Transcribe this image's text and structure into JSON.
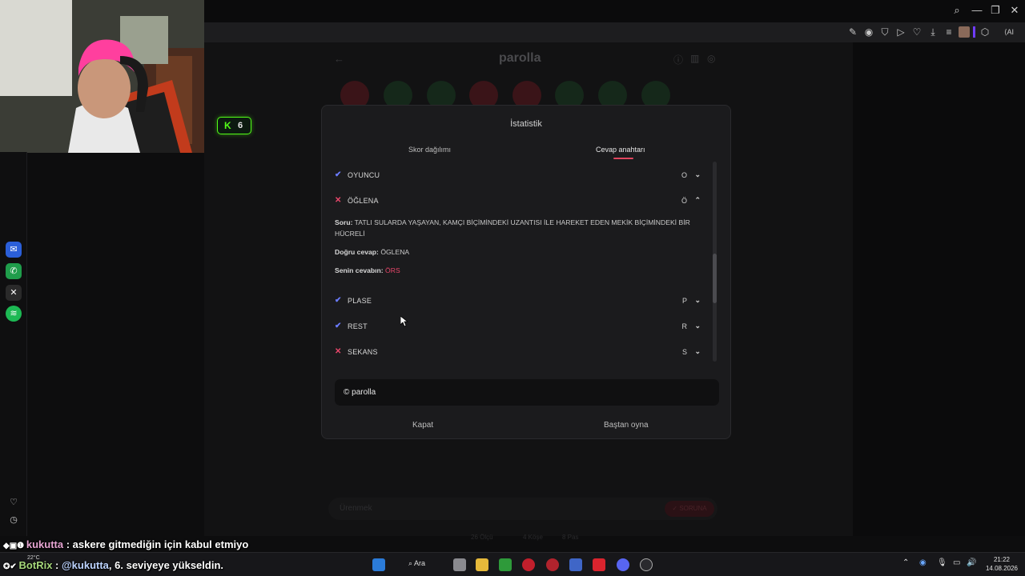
{
  "app": {
    "title": "parolla",
    "badge_count": "6"
  },
  "browser": {
    "toolbar_right_label": "AI"
  },
  "modal": {
    "title": "İstatistik",
    "tabs": [
      {
        "label": "Skor dağılımı",
        "active": false
      },
      {
        "label": "Cevap anahtarı",
        "active": true
      }
    ],
    "rows": [
      {
        "word": "OYUNCU",
        "letter": "O",
        "correct": true,
        "expanded": false
      },
      {
        "word": "ÖĞLENA",
        "letter": "Ö",
        "correct": false,
        "expanded": true
      },
      {
        "word": "PLASE",
        "letter": "P",
        "correct": true,
        "expanded": false
      },
      {
        "word": "REST",
        "letter": "R",
        "correct": true,
        "expanded": false
      },
      {
        "word": "SEKANS",
        "letter": "S",
        "correct": false,
        "expanded": false
      }
    ],
    "detail": {
      "question_label": "Soru:",
      "question_text": "TATLI SULARDA YAŞAYAN, KAMÇI BİÇİMİNDEKİ UZANTISI İLE HAREKET EDEN MEKİK BİÇİMİNDEKİ BİR HÜCRELİ",
      "correct_label": "Doğru cevap:",
      "correct_text": "ÖGLENA",
      "your_label": "Senin cevabın:",
      "your_text": "ÖRS"
    },
    "footer_text": "© parolla",
    "close_label": "Kapat",
    "restart_label": "Baştan oyna"
  },
  "background": {
    "input_placeholder": "Ürenmek",
    "submit_label": "✓ SORUNA",
    "stats": [
      "26 Ölçü",
      "4 Köşe",
      "8 Pas"
    ]
  },
  "chat": [
    {
      "user": "kukutta",
      "message": " : askere gitmediğin için kabul etmiyo"
    },
    {
      "user": "BotRix",
      "mention": "@kukutta",
      "message": ", 6. seviyeye yükseldin."
    }
  ],
  "taskbar": {
    "search_label": "Ara",
    "temperature": "22°C",
    "time": "21:22",
    "date": "14.08.2026"
  },
  "colors": {
    "accent": "#e0465f",
    "correct": "#6b7cff",
    "wrong": "#e8476a"
  }
}
